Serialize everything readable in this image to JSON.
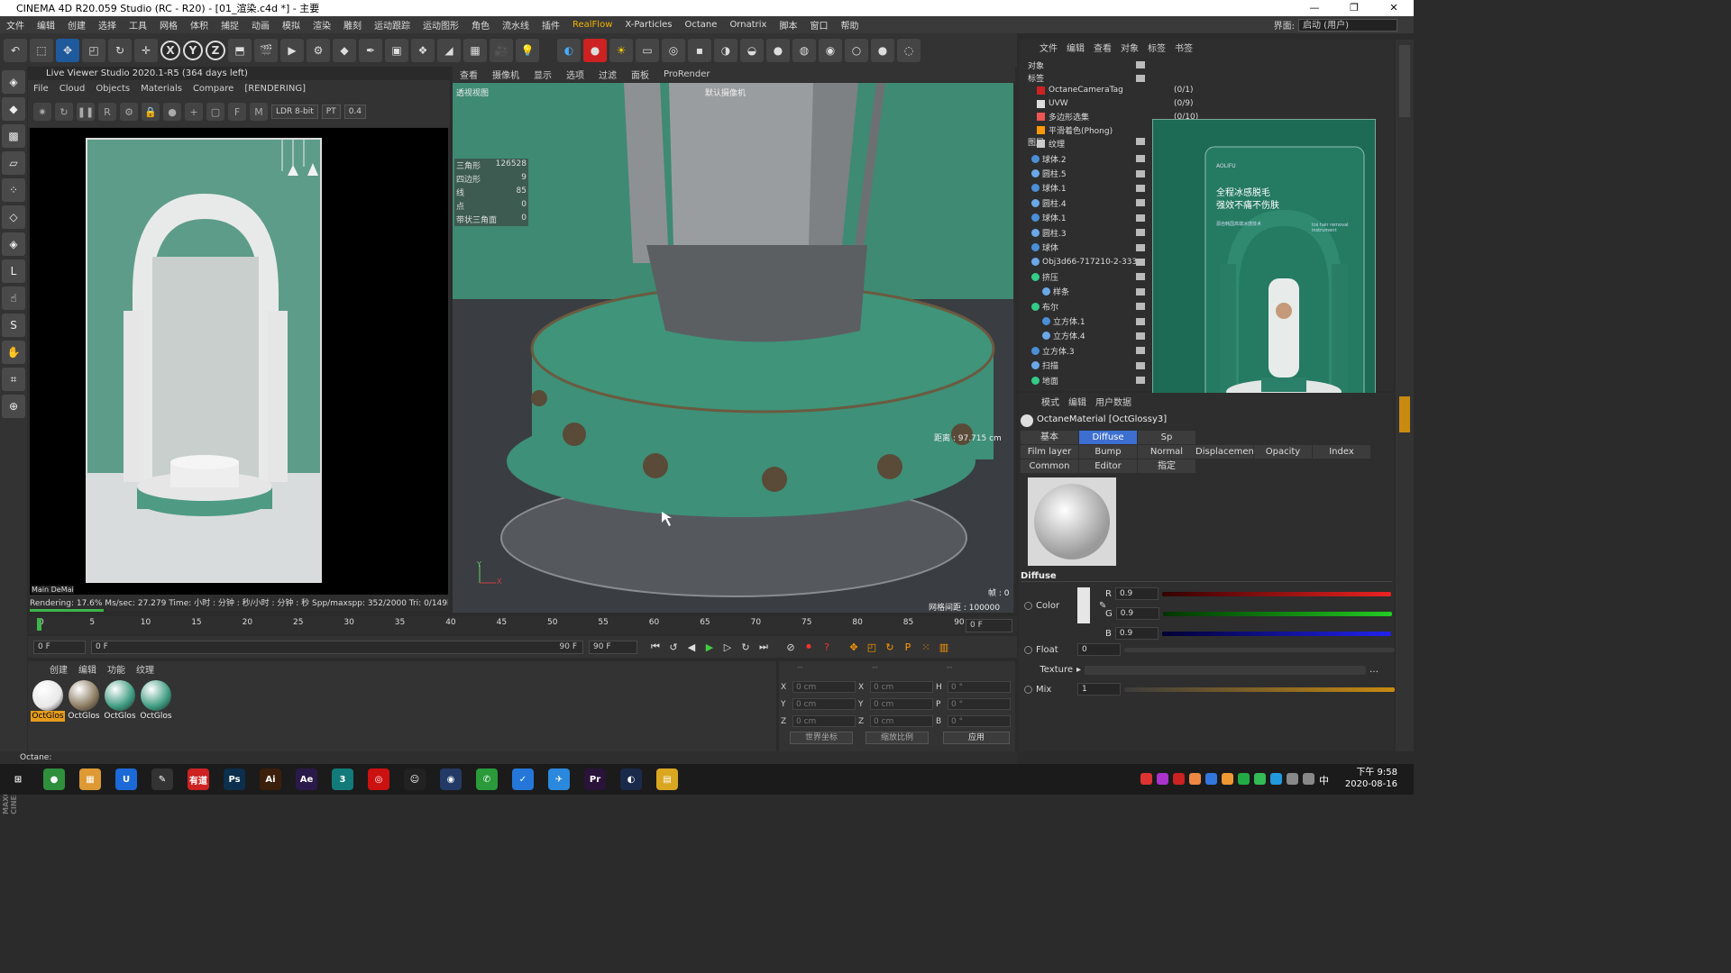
{
  "window": {
    "title": "CINEMA 4D R20.059 Studio (RC - R20) - [01_渲染.c4d *] - 主要",
    "minimize": "—",
    "maximize": "❐",
    "close": "✕"
  },
  "menu": {
    "items": [
      "文件",
      "编辑",
      "创建",
      "选择",
      "工具",
      "网格",
      "体积",
      "捕捉",
      "动画",
      "模拟",
      "渲染",
      "雕刻",
      "运动跟踪",
      "运动图形",
      "角色",
      "流水线",
      "插件",
      "RealFlow",
      "X-Particles",
      "Octane",
      "Ornatrix",
      "脚本",
      "窗口",
      "帮助"
    ],
    "layout_label": "界面:",
    "layout_value": "启动 (用户)"
  },
  "toolbar": {
    "axis": [
      "X",
      "Y",
      "Z"
    ]
  },
  "live_viewer": {
    "title": "Live Viewer Studio 2020.1-R5 (364 days left)",
    "menu": [
      "File",
      "Cloud",
      "Objects",
      "Materials",
      "Compare",
      "[RENDERING]"
    ],
    "ldr": "LDR 8-bit",
    "pt": "PT",
    "value": "0.4",
    "tabs": "Main DeMai",
    "status": "Rendering: 17.6%   Ms/sec: 27.279   Time: 小时 : 分钟 : 秒/小时 : 分钟 : 秒   Spp/maxspp: 352/2000   Tri: 0/149k   Mesh:",
    "progress": 0.176
  },
  "viewport": {
    "menu": [
      "查看",
      "摄像机",
      "显示",
      "选项",
      "过滤",
      "面板",
      "ProRender"
    ],
    "label": "透视视图",
    "camera": "默认摄像机",
    "distance": "距离 : 97.715 cm",
    "grid": "网格间距 : 100000 cm",
    "frame": "帧 : 0",
    "axis_y": "Y",
    "axis_x": "X",
    "stats": [
      {
        "k": "三角形",
        "v": "126528"
      },
      {
        "k": "四边形",
        "v": "9"
      },
      {
        "k": "线",
        "v": "85"
      },
      {
        "k": "点",
        "v": "0"
      },
      {
        "k": "带状三角面",
        "v": "0"
      }
    ]
  },
  "timeline": {
    "ticks": [
      "0",
      "5",
      "10",
      "15",
      "20",
      "25",
      "30",
      "35",
      "40",
      "45",
      "50",
      "55",
      "60",
      "65",
      "70",
      "75",
      "80",
      "85",
      "90"
    ],
    "end_field": "0 F"
  },
  "transport": {
    "start": "0 F",
    "cur": "0 F",
    "end_range": "90 F",
    "end": "90 F"
  },
  "material_manager": {
    "menu": [
      "创建",
      "编辑",
      "功能",
      "纹理"
    ],
    "materials": [
      {
        "name": "OctGlos",
        "color": "#e8e8e8"
      },
      {
        "name": "OctGlos",
        "color": "#8a7a60"
      },
      {
        "name": "OctGlos",
        "color": "#3d9b80"
      },
      {
        "name": "OctGlos",
        "color": "#3d9b80"
      }
    ]
  },
  "coords": {
    "header": [
      "--",
      "--",
      "--"
    ],
    "rows": [
      {
        "a": "X",
        "av": "0 cm",
        "b": "X",
        "bv": "0 cm",
        "c": "H",
        "cv": "0 °"
      },
      {
        "a": "Y",
        "av": "0 cm",
        "b": "Y",
        "bv": "0 cm",
        "c": "P",
        "cv": "0 °"
      },
      {
        "a": "Z",
        "av": "0 cm",
        "b": "Z",
        "bv": "0 cm",
        "c": "B",
        "cv": "0 °"
      }
    ],
    "world": "世界坐标",
    "scale": "缩放比例",
    "apply": "应用"
  },
  "status": "Octane:",
  "object_manager": {
    "menu": [
      "文件",
      "编辑",
      "查看",
      "对象",
      "标签",
      "书签"
    ],
    "items": [
      "对象",
      "标签",
      "图层",
      "球体.2",
      "圆柱.5",
      "球体.1",
      "圆柱.4",
      "球体.1",
      "圆柱.3",
      "球体",
      "Obj3d66-717210-2-333",
      "挤压",
      "样条",
      "布尔",
      "立方体.1",
      "立方体.4",
      "立方体.3",
      "扫描",
      "地面"
    ],
    "tags": [
      "OctaneCameraTag",
      "UVW",
      "多边形选集",
      "平滑着色(Phong)",
      "纹理"
    ],
    "counts": [
      "(0/1)",
      "(0/9)",
      "(0/10)"
    ]
  },
  "attributes": {
    "menu": [
      "模式",
      "编辑",
      "用户数据"
    ],
    "name": "OctaneMaterial [OctGlossy3]",
    "tabs": [
      "基本",
      "Diffuse",
      "Sp",
      "Film layer",
      "Bump",
      "Normal",
      "Common",
      "Editor",
      "指定"
    ],
    "extra_tabs": [
      "Displacement",
      "Opacity",
      "Index"
    ],
    "section": "Diffuse",
    "color_label": "Color",
    "r": "0.9",
    "g": "0.9",
    "b": "0.9",
    "float_label": "Float",
    "float_val": "0",
    "texture_label": "Texture",
    "mix_label": "Mix",
    "mix_val": "1",
    "r_label": "R",
    "g_label": "G",
    "b_label": "B"
  },
  "reference": {
    "brand": "AOLIFU",
    "line1": "全程冰感脱毛",
    "line2": "强效不痛不伤肤",
    "sub": "源自韩国高端冰感技术",
    "en": "Ice hair removal instrument"
  },
  "taskbar": {
    "time": "下午 9:58",
    "date": "2020-08-16",
    "ime": "中",
    "apps": [
      {
        "label": "⊞",
        "color": "#1b1b1b"
      },
      {
        "label": "●",
        "color": "#2f8f3c"
      },
      {
        "label": "▦",
        "color": "#d93"
      },
      {
        "label": "U",
        "color": "#1c6ad8"
      },
      {
        "label": "✎",
        "color": "#333"
      },
      {
        "label": "有道",
        "color": "#c22"
      },
      {
        "label": "Ps",
        "color": "#0b2f4d"
      },
      {
        "label": "Ai",
        "color": "#3b1f0b"
      },
      {
        "label": "Ae",
        "color": "#2a1a4a"
      },
      {
        "label": "3",
        "color": "#137a7a"
      },
      {
        "label": "◎",
        "color": "#c11"
      },
      {
        "label": "☺",
        "color": "#222"
      },
      {
        "label": "◉",
        "color": "#233a66"
      },
      {
        "label": "✆",
        "color": "#2a9a3a"
      },
      {
        "label": "✓",
        "color": "#2477d8"
      },
      {
        "label": "✈",
        "color": "#2a88dd"
      },
      {
        "label": "Pr",
        "color": "#2a1338"
      },
      {
        "label": "◐",
        "color": "#1a2a4a"
      },
      {
        "label": "▤",
        "color": "#d9a620"
      }
    ]
  }
}
